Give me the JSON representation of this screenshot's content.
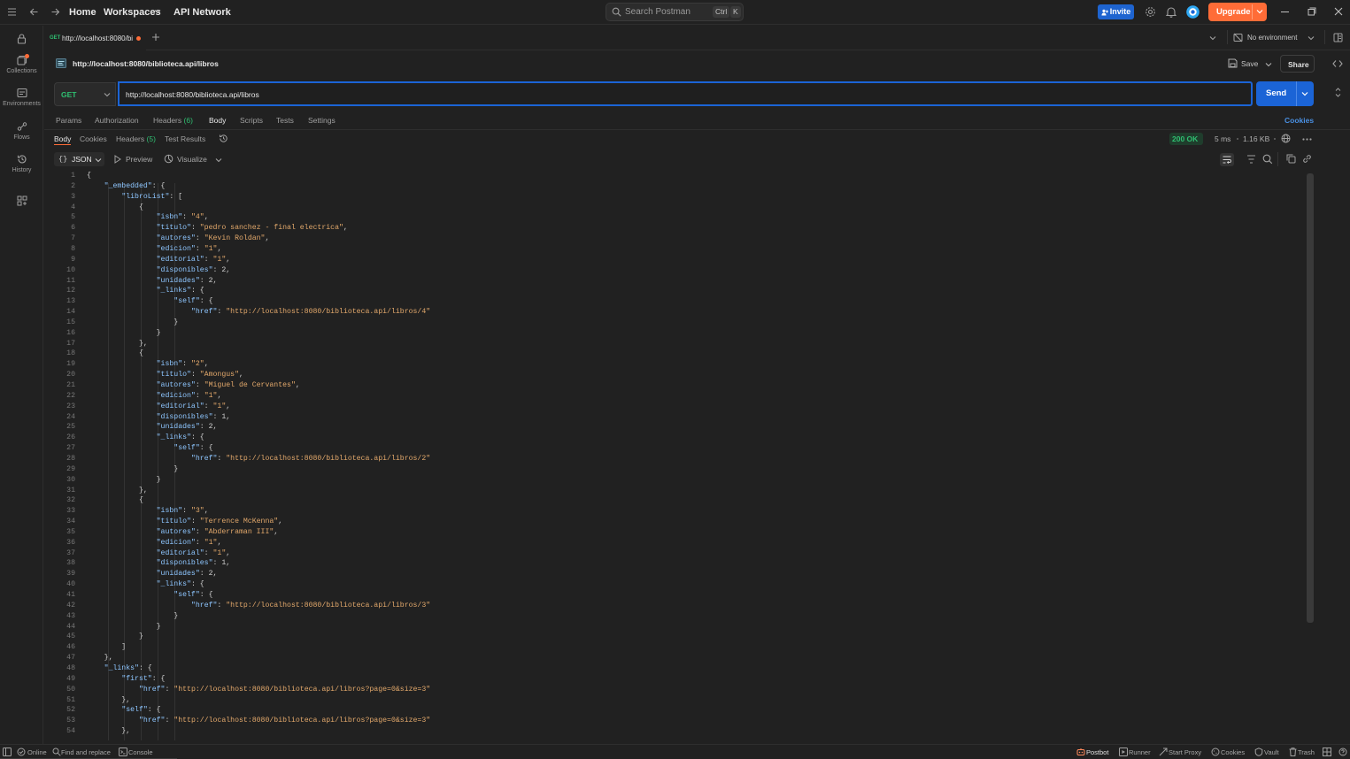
{
  "topbar": {
    "home": "Home",
    "workspaces": "Workspaces",
    "api_network": "API Network",
    "search_placeholder": "Search Postman",
    "kbd_ctrl": "Ctrl",
    "kbd_k": "K",
    "invite": "Invite",
    "upgrade": "Upgrade"
  },
  "sidebar": {
    "items": [
      {
        "label": "Collections",
        "icon": "collections-icon"
      },
      {
        "label": "Environments",
        "icon": "environments-icon"
      },
      {
        "label": "Flows",
        "icon": "flows-icon"
      },
      {
        "label": "History",
        "icon": "history-icon"
      }
    ]
  },
  "tabs": {
    "active": {
      "method": "GET",
      "label": "http://localhost:8080/bi"
    },
    "environment": "No environment"
  },
  "request": {
    "title": "http://localhost:8080/biblioteca.api/libros",
    "save": "Save",
    "share": "Share",
    "method": "GET",
    "url": "http://localhost:8080/biblioteca.api/libros",
    "send": "Send",
    "tabs": [
      "Params",
      "Authorization",
      "Headers",
      "Body",
      "Scripts",
      "Tests",
      "Settings"
    ],
    "headers_count": "(6)",
    "cookies": "Cookies"
  },
  "response": {
    "tabs": [
      "Body",
      "Cookies",
      "Headers",
      "Test Results"
    ],
    "headers_count": "(5)",
    "status": "200 OK",
    "time": "5 ms",
    "size": "1.16 KB",
    "format": "JSON",
    "preview": "Preview",
    "visualize": "Visualize"
  },
  "code_lines": [
    "{",
    "    \"_embedded\": {",
    "        \"libroList\": [",
    "            {",
    "                \"isbn\": \"4\",",
    "                \"titulo\": \"pedro sanchez - final electrica\",",
    "                \"autores\": \"Kevin Roldan\",",
    "                \"edicion\": \"1\",",
    "                \"editorial\": \"1\",",
    "                \"disponibles\": 2,",
    "                \"unidades\": 2,",
    "                \"_links\": {",
    "                    \"self\": {",
    "                        \"href\": \"http://localhost:8080/biblioteca.api/libros/4\"",
    "                    }",
    "                }",
    "            },",
    "            {",
    "                \"isbn\": \"2\",",
    "                \"titulo\": \"Amongus\",",
    "                \"autores\": \"Miguel de Cervantes\",",
    "                \"edicion\": \"1\",",
    "                \"editorial\": \"1\",",
    "                \"disponibles\": 1,",
    "                \"unidades\": 2,",
    "                \"_links\": {",
    "                    \"self\": {",
    "                        \"href\": \"http://localhost:8080/biblioteca.api/libros/2\"",
    "                    }",
    "                }",
    "            },",
    "            {",
    "                \"isbn\": \"3\",",
    "                \"titulo\": \"Terrence McKenna\",",
    "                \"autores\": \"Abderraman III\",",
    "                \"edicion\": \"1\",",
    "                \"editorial\": \"1\",",
    "                \"disponibles\": 1,",
    "                \"unidades\": 2,",
    "                \"_links\": {",
    "                    \"self\": {",
    "                        \"href\": \"http://localhost:8080/biblioteca.api/libros/3\"",
    "                    }",
    "                }",
    "            }",
    "        ]",
    "    },",
    "    \"_links\": {",
    "        \"first\": {",
    "            \"href\": \"http://localhost:8080/biblioteca.api/libros?page=0&size=3\"",
    "        },",
    "        \"self\": {",
    "            \"href\": \"http://localhost:8080/biblioteca.api/libros?page=0&size=3\"",
    "        },"
  ],
  "statusbar": {
    "online": "Online",
    "find_replace": "Find and replace",
    "console": "Console",
    "postbot": "Postbot",
    "runner": "Runner",
    "start_proxy": "Start Proxy",
    "cookies": "Cookies",
    "vault": "Vault",
    "trash": "Trash"
  },
  "colors": {
    "accent": "#1b64d6",
    "brand": "#ff6c37",
    "status_ok": "#2fbf71",
    "json_key": "#8ec6ff",
    "json_string": "#e2a86b"
  }
}
